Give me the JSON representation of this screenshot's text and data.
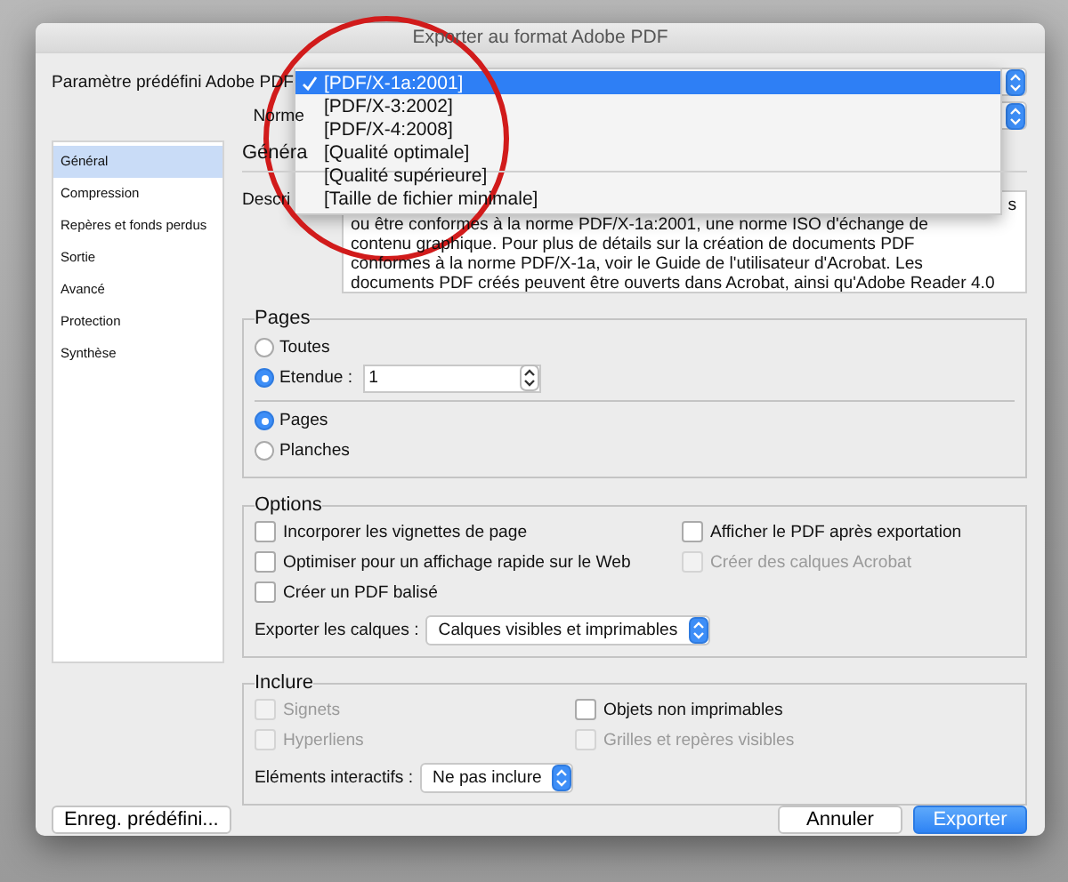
{
  "window": {
    "title": "Exporter au format Adobe PDF"
  },
  "preset": {
    "label": "Paramètre prédéfini Adobe PDF"
  },
  "standard": {
    "label": "Norme"
  },
  "dropdown": {
    "items": [
      {
        "label": "[PDF/X-1a:2001]",
        "selected": true
      },
      {
        "label": "[PDF/X-3:2002]",
        "selected": false
      },
      {
        "label": "[PDF/X-4:2008]",
        "selected": false
      },
      {
        "label": "[Qualité optimale]",
        "selected": false
      },
      {
        "label": "[Qualité supérieure]",
        "selected": false
      },
      {
        "label": "[Taille de fichier minimale]",
        "selected": false
      }
    ]
  },
  "sidebar": {
    "items": [
      {
        "label": "Général",
        "selected": true
      },
      {
        "label": "Compression",
        "selected": false
      },
      {
        "label": "Repères et fonds perdus",
        "selected": false
      },
      {
        "label": "Sortie",
        "selected": false
      },
      {
        "label": "Avancé",
        "selected": false
      },
      {
        "label": "Protection",
        "selected": false
      },
      {
        "label": "Synthèse",
        "selected": false
      }
    ]
  },
  "section_title": "Généra",
  "description": {
    "label": "Descri",
    "first_line_tail": "s",
    "lines": [
      "ou être conformes à la norme PDF/X-1a:2001, une norme ISO d'échange de",
      "contenu graphique. Pour plus de détails sur la création de documents PDF",
      "conformes à la norme PDF/X-1a, voir le Guide de l'utilisateur d'Acrobat. Les",
      "documents PDF créés peuvent être ouverts dans Acrobat, ainsi qu'Adobe Reader 4.0"
    ]
  },
  "pages": {
    "title": "Pages",
    "range_options": [
      {
        "label": "Toutes",
        "selected": false
      },
      {
        "label": "Etendue :",
        "selected": true
      }
    ],
    "range_value": "1",
    "layout_options": [
      {
        "label": "Pages",
        "selected": true
      },
      {
        "label": "Planches",
        "selected": false
      }
    ]
  },
  "options": {
    "title": "Options",
    "checkboxes": [
      {
        "label": "Incorporer les vignettes de page",
        "checked": false,
        "disabled": false
      },
      {
        "label": "Afficher le PDF après exportation",
        "checked": false,
        "disabled": false
      },
      {
        "label": "Optimiser pour un affichage rapide sur le Web",
        "checked": false,
        "disabled": false
      },
      {
        "label": "Créer des calques Acrobat",
        "checked": false,
        "disabled": true
      },
      {
        "label": "Créer un PDF balisé",
        "checked": false,
        "disabled": false
      }
    ],
    "layers": {
      "label": "Exporter les calques :",
      "value": "Calques visibles et imprimables"
    }
  },
  "include": {
    "title": "Inclure",
    "checkboxes": [
      {
        "label": "Signets",
        "checked": false,
        "disabled": true
      },
      {
        "label": "Objets non imprimables",
        "checked": false,
        "disabled": false
      },
      {
        "label": "Hyperliens",
        "checked": false,
        "disabled": true
      },
      {
        "label": "Grilles et repères visibles",
        "checked": false,
        "disabled": true
      }
    ],
    "interactive": {
      "label": "Eléments interactifs :",
      "value": "Ne pas inclure"
    }
  },
  "buttons": {
    "save_preset": "Enreg. prédéfini...",
    "cancel": "Annuler",
    "export": "Exporter"
  }
}
